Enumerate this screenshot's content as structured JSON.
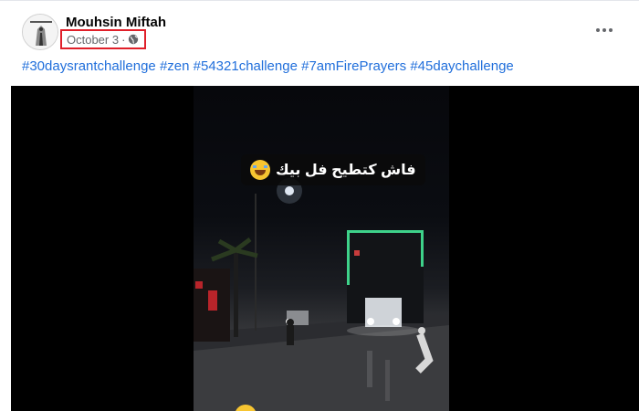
{
  "post": {
    "author": "Mouhsin Miftah",
    "date": "October 3",
    "separator": "·",
    "audience_icon": "globe-icon",
    "more_icon": "more-options-icon",
    "hashtags": [
      "#30daysrantchallenge",
      "#zen",
      "#54321challenge",
      "#7amFirePrayers",
      "#45daychallenge"
    ]
  },
  "video": {
    "caption": "فاش كتطيح فل بيك",
    "caption_emoji": "laughing-tears-emoji-icon"
  },
  "colors": {
    "link": "#216fdb",
    "author": "#050505",
    "meta": "#65676b",
    "highlight_border": "#e0202a",
    "video_bg": "#000000"
  }
}
